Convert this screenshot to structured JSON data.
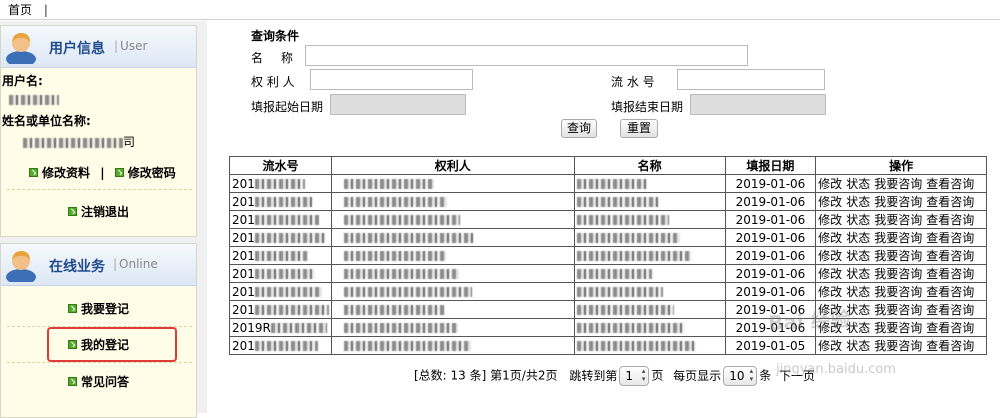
{
  "topbar": {
    "home": "首页",
    "sep": "|"
  },
  "user_panel": {
    "title": "用户信息",
    "subtitle": "User",
    "username_label": "用户名:",
    "org_label": "姓名或单位名称:",
    "org_suffix": "司",
    "edit_profile": "修改资料",
    "divider": "|",
    "change_password": "修改密码",
    "logout": "注销退出"
  },
  "business_panel": {
    "title": "在线业务",
    "subtitle": "Online",
    "items": [
      "我要登记",
      "我的登记",
      "常见问答"
    ]
  },
  "query": {
    "title": "查询条件",
    "name_label": "名 称",
    "owner_label": "权 利 人",
    "serial_label": "流 水 号",
    "start_label": "填报起始日期",
    "end_label": "填报结束日期",
    "search_button": "查询",
    "reset_button": "重置"
  },
  "table": {
    "headers": [
      "流水号",
      "权利人",
      "名称",
      "填报日期",
      "操作"
    ],
    "rows": [
      {
        "serial_prefix": "201",
        "date": "2019-01-06"
      },
      {
        "serial_prefix": "201",
        "date": "2019-01-06"
      },
      {
        "serial_prefix": "201",
        "date": "2019-01-06"
      },
      {
        "serial_prefix": "201",
        "date": "2019-01-06"
      },
      {
        "serial_prefix": "201",
        "date": "2019-01-06"
      },
      {
        "serial_prefix": "201",
        "date": "2019-01-06"
      },
      {
        "serial_prefix": "201",
        "date": "2019-01-06"
      },
      {
        "serial_prefix": "201",
        "date": "2019-01-06"
      },
      {
        "serial_prefix": "2019R",
        "date": "2019-01-06"
      },
      {
        "serial_prefix": "201",
        "date": "2019-01-05"
      }
    ],
    "actions": [
      "修改",
      "状态",
      "我要咨询",
      "查看咨询"
    ]
  },
  "pager": {
    "total_prefix": "[总数: ",
    "total": "13",
    "total_suffix": " 条]",
    "page_info": "第1页/共2页",
    "jump_prefix": "跳转到第",
    "jump_value": "1",
    "jump_suffix": "页",
    "per_page_prefix": "每页显示",
    "per_page_value": "10",
    "per_page_suffix": "条",
    "next": "下一页"
  },
  "watermark": {
    "text": "Bai 经验",
    "url": "jingyan.baidu.com"
  },
  "colors": {
    "highlight": "#e03a3a",
    "panel_title": "#1f4b8e",
    "icon_green": "#58a92b"
  }
}
